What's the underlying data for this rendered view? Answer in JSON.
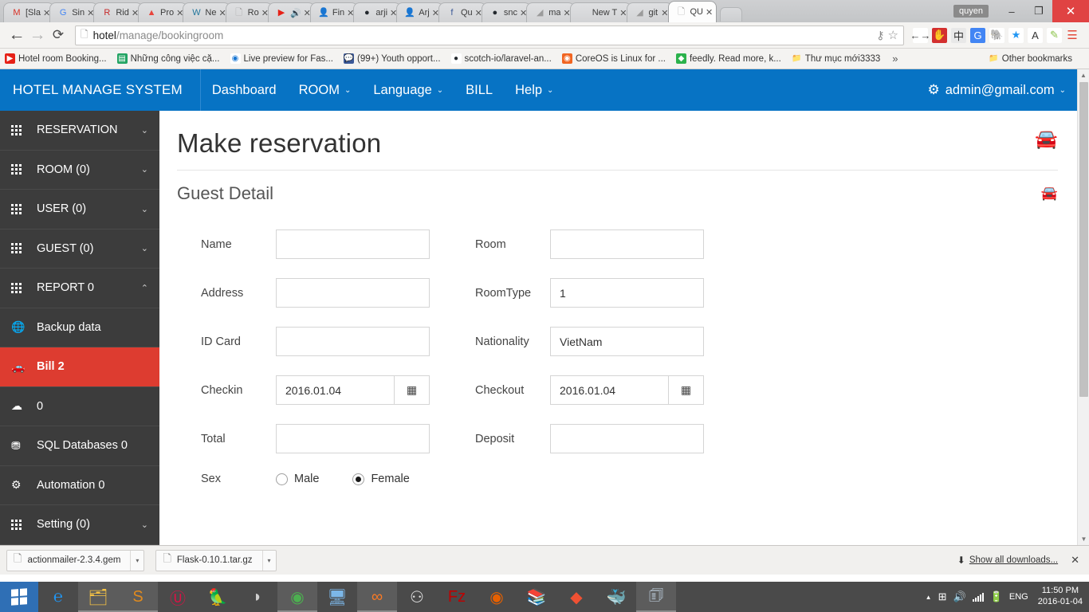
{
  "browser": {
    "tabs": [
      {
        "label": "[Sla",
        "icon": "gmail-icon",
        "glyph": "M",
        "color": "#d93025"
      },
      {
        "label": "Sin",
        "icon": "google-icon",
        "glyph": "G",
        "color": "#4285f4"
      },
      {
        "label": "Rid",
        "icon": "reddit-icon",
        "glyph": "R",
        "color": "#c62828"
      },
      {
        "label": "Pro",
        "icon": "drive-icon",
        "glyph": "▲",
        "color": "#e8453c"
      },
      {
        "label": "Ne",
        "icon": "wordpress-icon",
        "glyph": "W",
        "color": "#21759b"
      },
      {
        "label": "Ro",
        "icon": "page-icon",
        "glyph": "🗋",
        "color": "#9e9e9e"
      },
      {
        "label": "",
        "icon": "youtube-icon",
        "glyph": "▶",
        "color": "#e62117",
        "extra": "🔊"
      },
      {
        "label": "Fin",
        "icon": "avatar-icon",
        "glyph": "👤",
        "color": "#8d6e63"
      },
      {
        "label": "arji",
        "icon": "github-icon",
        "glyph": "●",
        "color": "#24292e"
      },
      {
        "label": "Arj",
        "icon": "avatar-icon",
        "glyph": "👤",
        "color": "#8d6e63"
      },
      {
        "label": "Qu",
        "icon": "facebook-icon",
        "glyph": "f",
        "color": "#3b5998"
      },
      {
        "label": "snc",
        "icon": "github-icon",
        "glyph": "●",
        "color": "#24292e"
      },
      {
        "label": "ma",
        "icon": "ruby-icon",
        "glyph": "◢",
        "color": "#9b9b9b"
      },
      {
        "label": "New T",
        "icon": "newtab-icon",
        "glyph": "",
        "color": "#bbbbbb"
      },
      {
        "label": "git",
        "icon": "ruby-icon",
        "glyph": "◢",
        "color": "#9b9b9b"
      },
      {
        "label": "QU",
        "icon": "page-icon",
        "glyph": "🗋",
        "color": "#9e9e9e",
        "active": true
      }
    ],
    "tab_close_glyph": "✕",
    "window": {
      "user": "quyen",
      "minimize": "–",
      "restore": "❐",
      "close": "✕"
    },
    "nav": {
      "back": "←",
      "forward": "→",
      "reload": "⟳",
      "page_icon": "🗋",
      "url_host": "hotel",
      "url_path": "/manage/bookingroom",
      "key_icon": "⚷",
      "star_icon": "☆",
      "menu_icon": "☰"
    },
    "extensions": [
      {
        "name": "translate-ext-icon",
        "glyph": "←→",
        "color": "#444",
        "bg": "#ffffff"
      },
      {
        "name": "adblock-ext-icon",
        "glyph": "✋",
        "color": "#ffffff",
        "bg": "#d32f2f"
      },
      {
        "name": "chinese-ext-icon",
        "glyph": "中",
        "color": "#333",
        "bg": "#e8e8e8"
      },
      {
        "name": "google-translate-ext-icon",
        "glyph": "G",
        "color": "#ffffff",
        "bg": "#4285f4"
      },
      {
        "name": "evernote-ext-icon",
        "glyph": "🐘",
        "color": "#5d5d5d",
        "bg": "#ffffff"
      },
      {
        "name": "star-ext-icon",
        "glyph": "★",
        "color": "#2196f3",
        "bg": "#ffffff"
      },
      {
        "name": "angular-ext-icon",
        "glyph": "A",
        "color": "#333",
        "bg": "#ffffff"
      },
      {
        "name": "colorpicker-ext-icon",
        "glyph": "✎",
        "color": "#8bc34a",
        "bg": "#ffffff"
      }
    ],
    "bookmarks": [
      {
        "label": "Hotel room Booking...",
        "icon": "youtube-bookmark-icon",
        "glyph": "▶",
        "color": "#ffffff",
        "bg": "#e62117"
      },
      {
        "label": "Những công việc cặ...",
        "icon": "sheets-bookmark-icon",
        "glyph": "▤",
        "color": "#ffffff",
        "bg": "#22a463"
      },
      {
        "label": "Live preview for Fas...",
        "icon": "preview-bookmark-icon",
        "glyph": "◉",
        "color": "#1976d2",
        "bg": "#ffffff"
      },
      {
        "label": "(99+) Youth opport...",
        "icon": "facebook-bookmark-icon",
        "glyph": "💬",
        "color": "#ffffff",
        "bg": "#3b5998"
      },
      {
        "label": "scotch-io/laravel-an...",
        "icon": "github-bookmark-icon",
        "glyph": "●",
        "color": "#24292e",
        "bg": "#ffffff"
      },
      {
        "label": "CoreOS is Linux for ...",
        "icon": "coreos-bookmark-icon",
        "glyph": "◉",
        "color": "#ffffff",
        "bg": "#f16521"
      },
      {
        "label": "feedly. Read more, k...",
        "icon": "feedly-bookmark-icon",
        "glyph": "◆",
        "color": "#ffffff",
        "bg": "#2bb24c"
      },
      {
        "label": "Thư mục mới3333",
        "icon": "folder-bookmark-icon",
        "glyph": "📁",
        "color": "#e8a33d",
        "bg": "transparent"
      }
    ],
    "bookmarks_overflow": "»",
    "other_bookmarks": {
      "label": "Other bookmarks",
      "icon": "folder-icon",
      "glyph": "📁"
    }
  },
  "app": {
    "brand": "HOTEL MANAGE SYSTEM",
    "nav_items": [
      {
        "label": "Dashboard",
        "caret": false
      },
      {
        "label": "ROOM",
        "caret": true
      },
      {
        "label": "Language",
        "caret": true
      },
      {
        "label": "BILL",
        "caret": false
      },
      {
        "label": "Help",
        "caret": true
      }
    ],
    "caret_glyph": "⌄",
    "account": {
      "email": "admin@gmail.com",
      "gear": "⚙",
      "caret": "⌄"
    }
  },
  "sidebar": {
    "items": [
      {
        "label": "RESERVATION",
        "icon": "grid-icon",
        "chevron": "⌄",
        "active": false
      },
      {
        "label": "ROOM (0)",
        "icon": "grid-icon",
        "chevron": "⌄",
        "active": false
      },
      {
        "label": "USER (0)",
        "icon": "grid-icon",
        "chevron": "⌄",
        "active": false
      },
      {
        "label": "GUEST (0)",
        "icon": "grid-icon",
        "chevron": "⌄",
        "active": false
      },
      {
        "label": "REPORT 0",
        "icon": "grid-icon",
        "chevron": "⌃",
        "active": false
      },
      {
        "label": "Backup data",
        "icon": "globe-icon",
        "glyph": "🌐",
        "chevron": "",
        "active": false
      },
      {
        "label": "Bill 2",
        "icon": "car-icon",
        "glyph": "🚗",
        "chevron": "",
        "active": true
      },
      {
        "label": "0",
        "icon": "cloud-icon",
        "glyph": "☁",
        "chevron": "",
        "active": false
      },
      {
        "label": "SQL Databases 0",
        "icon": "database-icon",
        "glyph": "⛃",
        "chevron": "",
        "active": false
      },
      {
        "label": "Automation 0",
        "icon": "gears-icon",
        "glyph": "⚙",
        "chevron": "",
        "active": false
      },
      {
        "label": "Setting (0)",
        "icon": "grid-icon",
        "chevron": "⌄",
        "active": false
      }
    ]
  },
  "main": {
    "page_title": "Make reservation",
    "section_title": "Guest Detail",
    "car_icon_glyph": "🚘",
    "calendar_icon_glyph": "▦",
    "form": {
      "rows": [
        {
          "left": {
            "label": "Name",
            "value": "",
            "type": "text"
          },
          "right": {
            "label": "Room",
            "value": "",
            "type": "text"
          }
        },
        {
          "left": {
            "label": "Address",
            "value": "",
            "type": "text"
          },
          "right": {
            "label": "RoomType",
            "value": "1",
            "type": "text"
          }
        },
        {
          "left": {
            "label": "ID Card",
            "value": "",
            "type": "text"
          },
          "right": {
            "label": "Nationality",
            "value": "VietNam",
            "type": "text"
          }
        },
        {
          "left": {
            "label": "Checkin",
            "value": "2016.01.04",
            "type": "date"
          },
          "right": {
            "label": "Checkout",
            "value": "2016.01.04",
            "type": "date"
          }
        },
        {
          "left": {
            "label": "Total",
            "value": "",
            "type": "text"
          },
          "right": {
            "label": "Deposit",
            "value": "",
            "type": "text"
          }
        }
      ],
      "sex": {
        "label": "Sex",
        "options": [
          {
            "label": "Male",
            "checked": false
          },
          {
            "label": "Female",
            "checked": true
          }
        ]
      }
    }
  },
  "downloads": {
    "items": [
      {
        "name": "actionmailer-2.3.4.gem",
        "icon": "file-icon",
        "glyph": "🗋",
        "caret": "▾"
      },
      {
        "name": "Flask-0.10.1.tar.gz",
        "icon": "file-icon",
        "glyph": "🗋",
        "caret": "▾"
      }
    ],
    "show_all": "Show all downloads...",
    "down_arrow": "⬇",
    "close": "✕"
  },
  "taskbar": {
    "apps": [
      {
        "name": "internet-explorer-icon",
        "glyph": "℮",
        "color": "#2196f3",
        "open": false
      },
      {
        "name": "file-explorer-icon",
        "glyph": "🗂",
        "color": "#f5c244",
        "open": true
      },
      {
        "name": "sublime-text-icon",
        "glyph": "S",
        "color": "#e08a1e",
        "open": true
      },
      {
        "name": "unikey-icon",
        "glyph": "Ⓤ",
        "color": "#d14",
        "open": false
      },
      {
        "name": "parrot-icon",
        "glyph": "🦜",
        "color": "#4caf50",
        "open": false
      },
      {
        "name": "mouse-icon",
        "glyph": "◗",
        "color": "#cfcfcf",
        "open": false
      },
      {
        "name": "chrome-icon",
        "glyph": "◉",
        "color": "#4caf50",
        "open": true
      },
      {
        "name": "network-tool-icon",
        "glyph": "🖥",
        "color": "#7cb7e8",
        "open": false
      },
      {
        "name": "xampp-icon",
        "glyph": "∞",
        "color": "#fb7a24",
        "open": true
      },
      {
        "name": "app-grid-icon",
        "glyph": "⚇",
        "color": "#e0e0e0",
        "open": false
      },
      {
        "name": "filezilla-icon",
        "glyph": "Fz",
        "color": "#bf0000",
        "open": false
      },
      {
        "name": "firefox-icon",
        "glyph": "◉",
        "color": "#e66000",
        "open": false
      },
      {
        "name": "winrar-icon",
        "glyph": "📚",
        "color": "#7e57c2",
        "open": false
      },
      {
        "name": "git-icon",
        "glyph": "◆",
        "color": "#f05133",
        "open": false
      },
      {
        "name": "docker-icon",
        "glyph": "🐳",
        "color": "#2496ed",
        "open": false
      },
      {
        "name": "notepad-icon",
        "glyph": "🗊",
        "color": "#cfe3f5",
        "open": true
      }
    ],
    "tray": {
      "expand": "▲",
      "network": "⊞",
      "volume": "🔊",
      "signal": "signal-bars",
      "battery": "🔋",
      "language": "ENG",
      "time": "11:50 PM",
      "date": "2016-01-04"
    }
  },
  "colors": {
    "app_blue": "#0773c4",
    "sidebar": "#3c3c3c",
    "active_red": "#dd3c30",
    "taskbar": "#4a4a4a"
  }
}
